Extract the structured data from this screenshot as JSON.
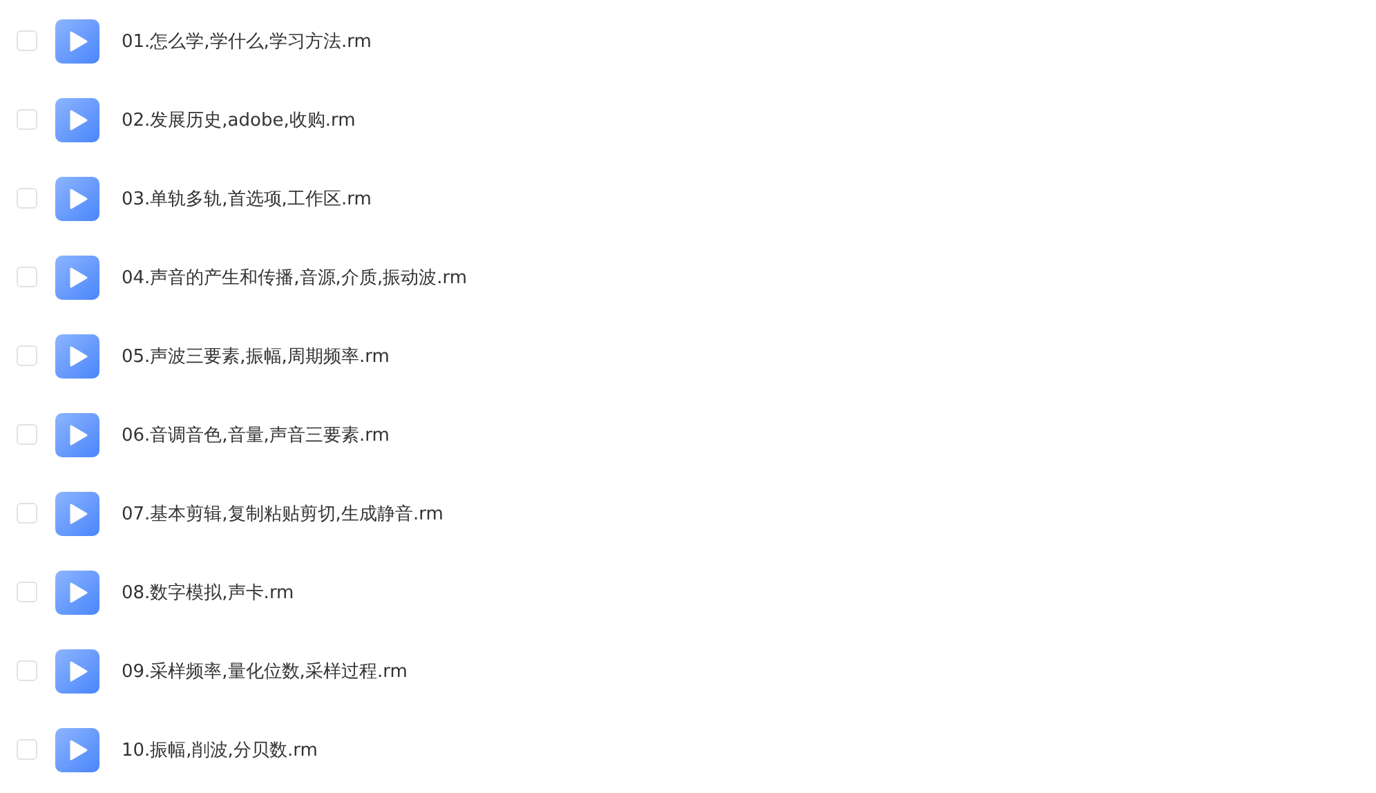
{
  "files": [
    {
      "name": "01.怎么学,学什么,学习方法.rm",
      "checked": false
    },
    {
      "name": "02.发展历史,adobe,收购.rm",
      "checked": false
    },
    {
      "name": "03.单轨多轨,首选项,工作区.rm",
      "checked": false
    },
    {
      "name": "04.声音的产生和传播,音源,介质,振动波.rm",
      "checked": false
    },
    {
      "name": "05.声波三要素,振幅,周期频率.rm",
      "checked": false
    },
    {
      "name": "06.音调音色,音量,声音三要素.rm",
      "checked": false
    },
    {
      "name": "07.基本剪辑,复制粘贴剪切,生成静音.rm",
      "checked": false
    },
    {
      "name": "08.数字模拟,声卡.rm",
      "checked": false
    },
    {
      "name": "09.采样频率,量化位数,采样过程.rm",
      "checked": false
    },
    {
      "name": "10.振幅,削波,分贝数.rm",
      "checked": false
    }
  ]
}
